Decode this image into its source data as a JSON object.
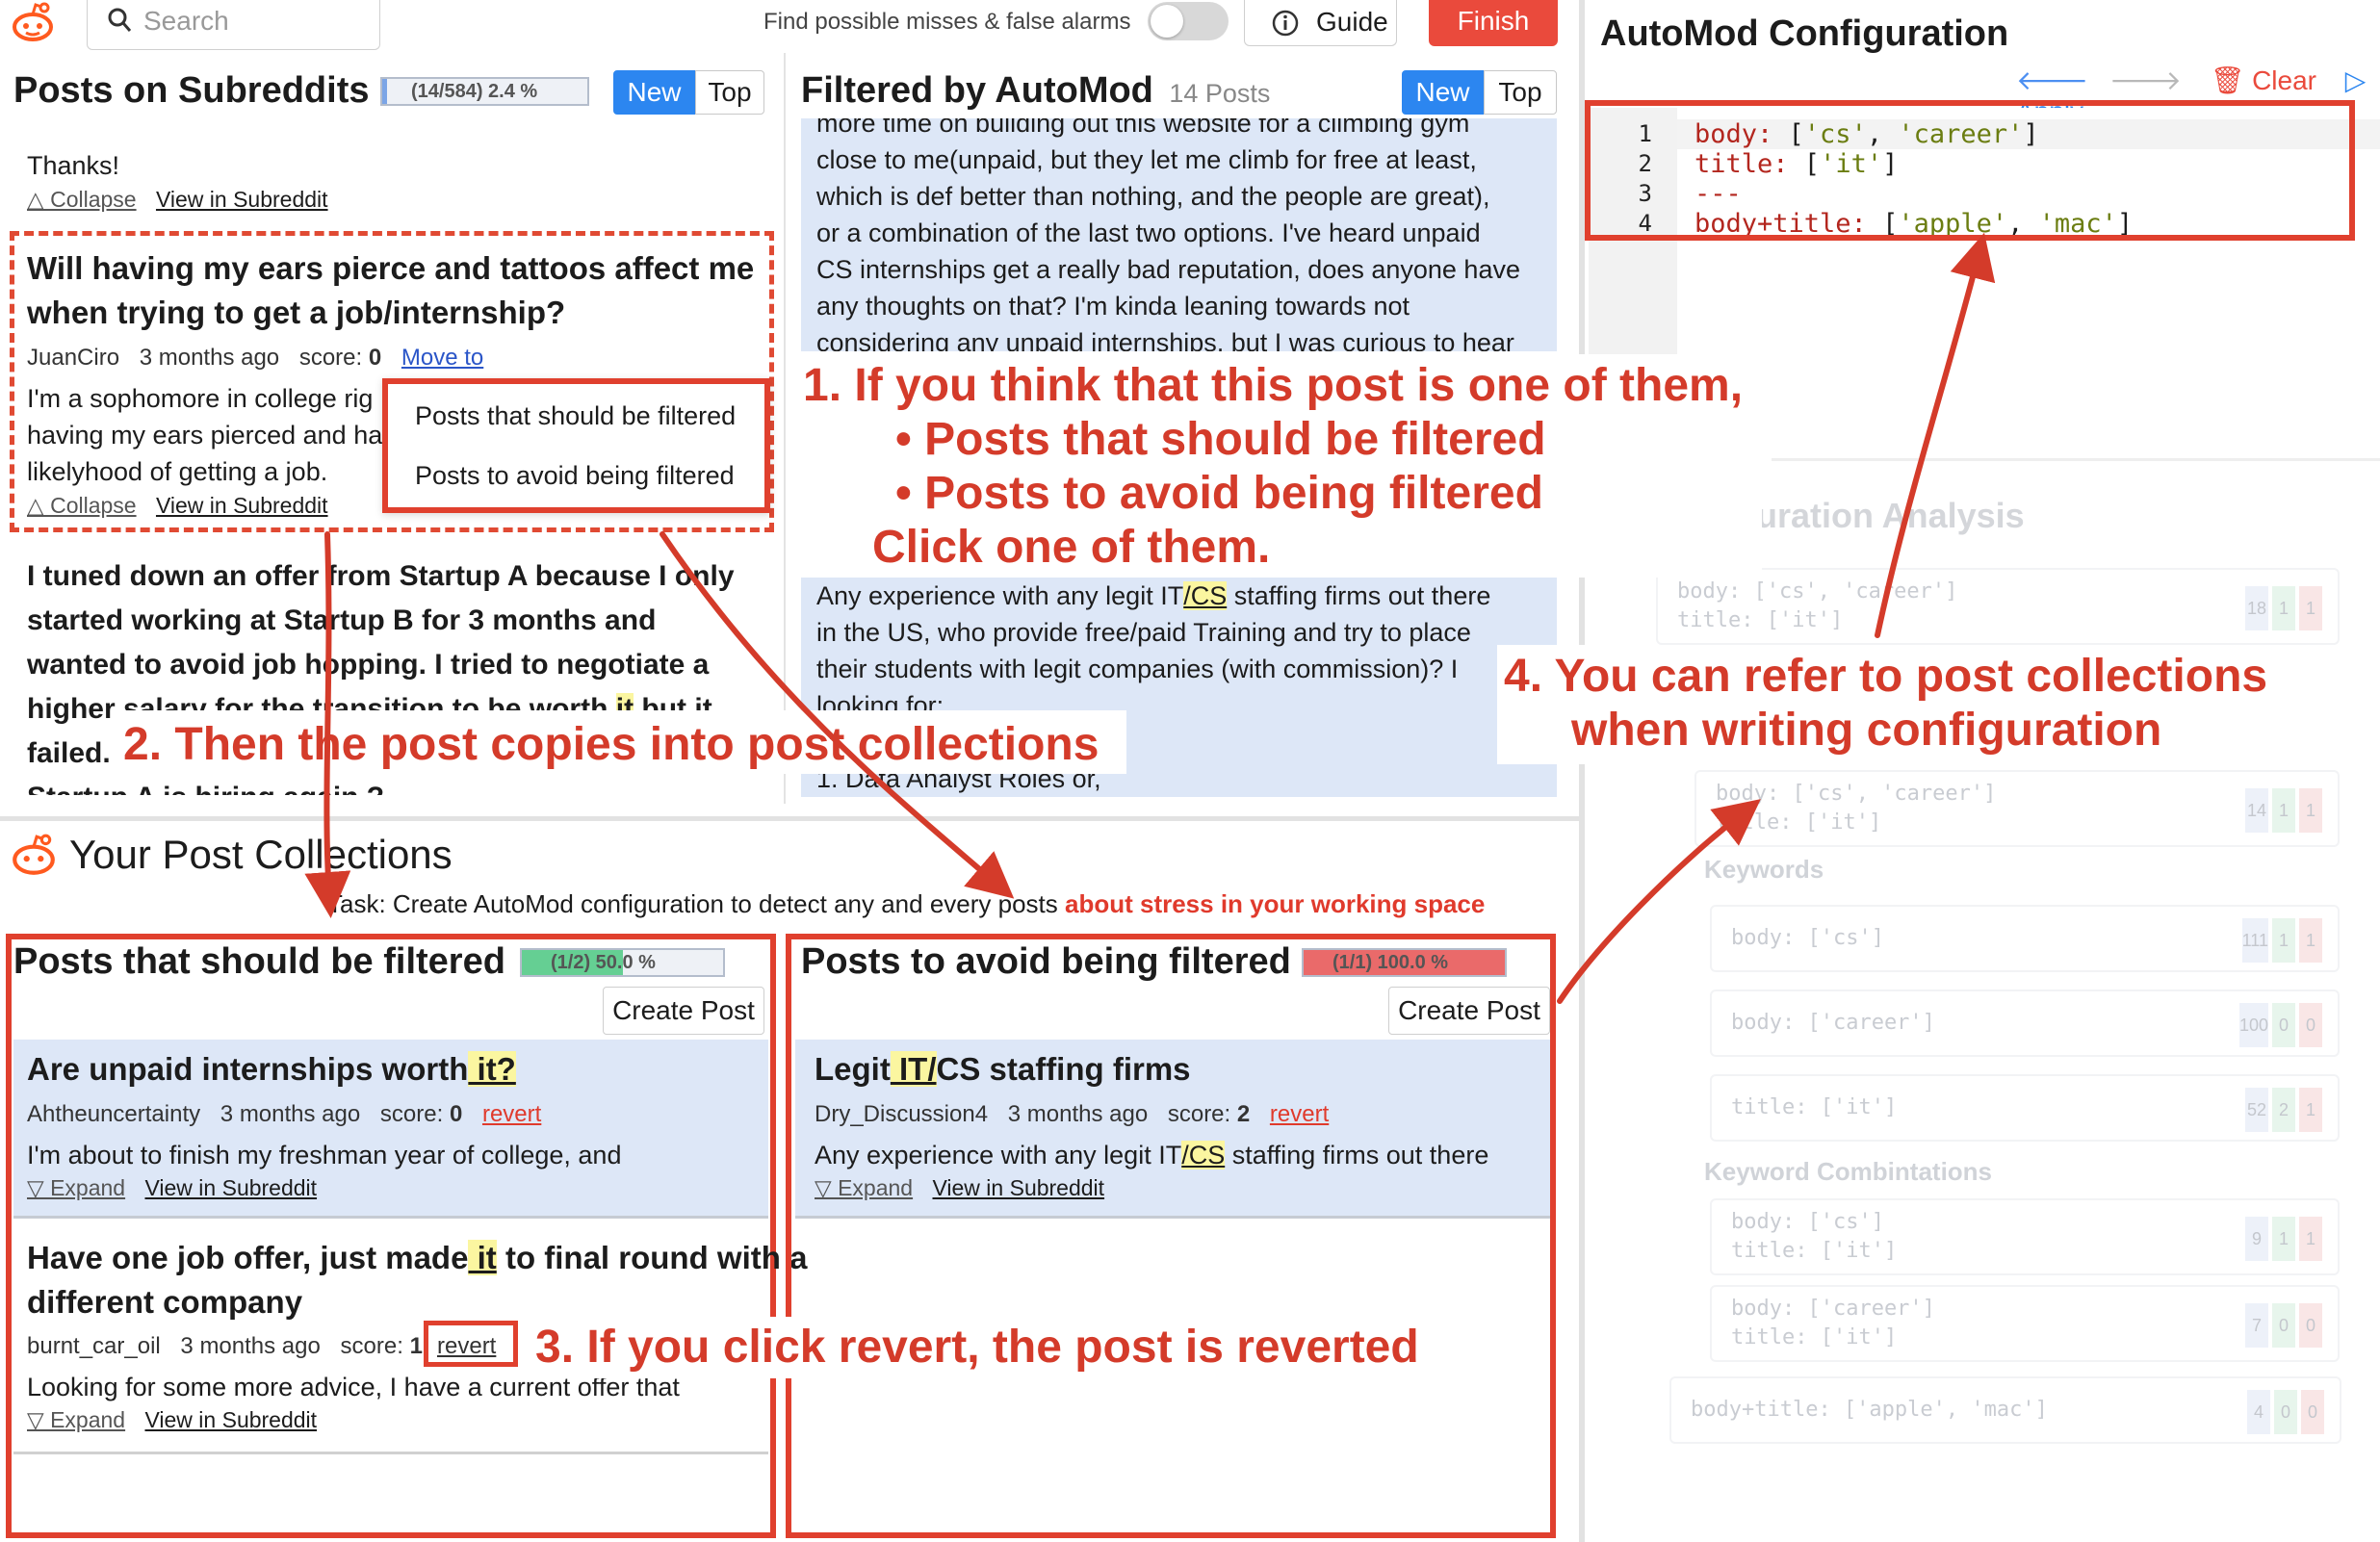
{
  "header": {
    "search_placeholder": "Search",
    "misses_label": "Find possible misses & false alarms",
    "guide_label": "Guide",
    "finish_label": "Finish"
  },
  "left": {
    "title": "Posts on Subreddits",
    "progress_text": "(14/584) 2.4 %",
    "progress": 0.024,
    "sort_new": "New",
    "sort_top": "Top",
    "prev_post": {
      "body": "Thanks!",
      "collapse": "△ Collapse",
      "view": "View in Subreddit"
    },
    "post1": {
      "title_line1": "Will having my ears pierce and tattoos affect me",
      "title_line2": "when trying to get a job/internship?",
      "author": "JuanCiro",
      "age": "3 months ago",
      "score_label": "score:",
      "score": "0",
      "move_to": "Move to",
      "body_line1": "I'm a sophomore in college rig",
      "body_line2": "having my ears pierced and ha",
      "body_line3": "likelyhood of getting a job.",
      "collapse": "△ Collapse",
      "view": "View in Subreddit"
    },
    "menu": {
      "item1": "Posts that should be filtered",
      "item2": "Posts to avoid being filtered"
    },
    "post2": {
      "line1": "I tuned down an offer from Startup A because I only",
      "line2": "started working at Startup B for 3 months and",
      "line3": "wanted to avoid job hopping. I tried to negotiate a",
      "line4a": "higher salary for the transition to be worth ",
      "line4hl": "it",
      "line4b": " but it",
      "line5": "failed.",
      "line6": "Startup A is hiring again ?"
    }
  },
  "middle": {
    "title": "Filtered by AutoMod",
    "count": "14 Posts",
    "sort_new": "New",
    "sort_top": "Top",
    "post1_lines": [
      "more time on building out this website for a climbing gym",
      "close to me(unpaid, but they let me climb for free at least,",
      "which is def better than nothing, and the people are great),",
      "or a combination of the last two options. I've heard unpaid",
      "CS internships get a really bad reputation, does anyone have",
      "any thoughts on that? I'm kinda leaning towards not",
      "considering any unpaid internships, but I was curious to hear"
    ],
    "post2": {
      "l1a": "Any experience with any legit IT",
      "l1hl": "/CS",
      "l1b": " staffing firms out there",
      "l2": "in the US, who provide free/paid Training and try to place",
      "l3": "their students with legit companies (with commission)? I",
      "l4": "looking for:",
      "l5": "1. Data Analyst Roles or,"
    }
  },
  "collections": {
    "title": "Your Post Collections",
    "task_prefix": "Task: Create AutoMod configuration to detect any and every posts ",
    "task_topic": "about stress in your working space",
    "filtered": {
      "title": "Posts that should be filtered",
      "progress_text": "(1/2) 50.0 %",
      "progress": 0.5,
      "create": "Create Post",
      "post1": {
        "title_a": "Are unpaid internships worth",
        "title_hl": " it?",
        "author": "Ahtheuncertainty",
        "age": "3 months ago",
        "score_label": "score:",
        "score": "0",
        "revert": "revert",
        "body": "I'm about to finish my freshman year of college, and",
        "expand": "▽ Expand",
        "view": "View in Subreddit"
      },
      "post2": {
        "title_a": "Have one job offer, just made",
        "title_hl": " it",
        "title_b": " to final round with a",
        "title_line2": "different company",
        "author": "burnt_car_oil",
        "age": "3 months ago",
        "score_label": "score:",
        "score": "1",
        "revert": "revert",
        "body": "Looking for some more advice, I have a current offer that",
        "expand": "▽ Expand",
        "view": "View in Subreddit"
      }
    },
    "avoid": {
      "title": "Posts to avoid being filtered",
      "progress_text": "(1/1) 100.0 %",
      "progress": 1.0,
      "create": "Create Post",
      "post1": {
        "title_a": "Legit",
        "title_hl": " IT/",
        "title_b": "CS staffing firms",
        "author": "Dry_Discussion4",
        "age": "3 months ago",
        "score_label": "score:",
        "score": "2",
        "revert": "revert",
        "body_a": "Any experience with any legit IT",
        "body_hl": "/CS",
        "body_b": " staffing firms out there",
        "expand": "▽ Expand",
        "view": "View in Subreddit"
      }
    }
  },
  "automod": {
    "title": "AutoMod Configuration",
    "clear": "Clear",
    "apply": "Apply",
    "code": [
      {
        "n": "1",
        "key": "body:",
        "vals": [
          "'cs'",
          "'career'"
        ]
      },
      {
        "n": "2",
        "key": "title:",
        "vals": [
          "'it'"
        ]
      },
      {
        "n": "3",
        "key": "---",
        "vals": []
      },
      {
        "n": "4",
        "key": "body+title:",
        "vals": [
          "'apple'",
          "'mac'"
        ]
      }
    ]
  },
  "analysis": {
    "title": "Configuration Analysis",
    "keywords_title": "Keywords",
    "combos_title": "Keyword Combintations",
    "rows": [
      {
        "t1": "body: ['cs', 'career']",
        "t2": "title: ['it']",
        "n": "18",
        "a": "1",
        "b": "1"
      },
      {
        "t1": "body: ['cs', 'career']",
        "t2": "title: ['it']",
        "n": "14",
        "a": "1",
        "b": "1"
      },
      {
        "t1": "body: ['cs']",
        "n": "111",
        "a": "1",
        "b": "1"
      },
      {
        "t1": "body: ['career']",
        "n": "100",
        "a": "0",
        "b": "0"
      },
      {
        "t1": "title: ['it']",
        "n": "52",
        "a": "2",
        "b": "1"
      },
      {
        "t1": "body: ['cs']",
        "t2": "title: ['it']",
        "n": "9",
        "a": "1",
        "b": "1"
      },
      {
        "t1": "body: ['career']",
        "t2": "title: ['it']",
        "n": "7",
        "a": "0",
        "b": "0"
      },
      {
        "t1": "body+title: ['apple', 'mac']",
        "n": "4",
        "a": "0",
        "b": "0"
      }
    ]
  },
  "annotations": {
    "a1_line1": "1.  If you think that this post is one of them,",
    "a1_b1": "•  Posts that should be filtered",
    "a1_b2": "•  Posts to avoid being filtered",
    "a1_line4": "Click one of them.",
    "a2": "2.  Then the post copies into post collections",
    "a3": "3.  If you click revert, the post is reverted",
    "a4_line1": "4.  You can refer to post collections",
    "a4_line2": "when writing configuration"
  },
  "colors": {
    "accent_blue": "#2c86f0",
    "annotation_red": "#d43b2a",
    "finish_red": "#ea4a3c",
    "post_bg": "#dde7f7",
    "highlight": "#fbf6a0"
  }
}
